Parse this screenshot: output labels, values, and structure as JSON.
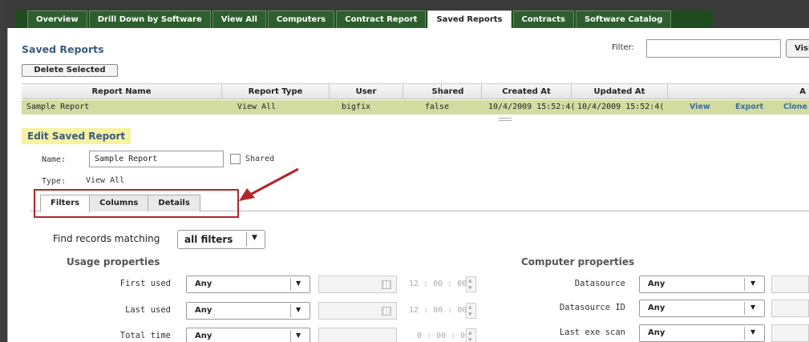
{
  "top_tabs": [
    {
      "label": "Overview",
      "active": false
    },
    {
      "label": "Drill Down by Software",
      "active": false
    },
    {
      "label": "View All",
      "active": false
    },
    {
      "label": "Computers",
      "active": false
    },
    {
      "label": "Contract Report",
      "active": false
    },
    {
      "label": "Saved Reports",
      "active": true
    },
    {
      "label": "Contracts",
      "active": false
    },
    {
      "label": "Software Catalog",
      "active": false
    }
  ],
  "page": {
    "title": "Saved Reports",
    "filter_label": "Filter:",
    "filter_value": "",
    "visible_button": "Visi",
    "delete_button": "Delete Selected"
  },
  "grid": {
    "columns": [
      "Report Name",
      "Report Type",
      "User",
      "Shared",
      "Created At",
      "Updated At",
      "A"
    ],
    "rows": [
      {
        "report_name": "Sample Report",
        "report_type": "View All",
        "user": "bigfix",
        "shared": "false",
        "created_at": "10/4/2009 15:52:4(",
        "updated_at": "10/4/2009 15:52:4(",
        "actions": [
          "View",
          "Export",
          "Clone"
        ]
      }
    ]
  },
  "edit": {
    "title": "Edit Saved Report",
    "name_label": "Name:",
    "name_value": "Sample Report",
    "shared_label": "Shared",
    "type_label": "Type:",
    "type_value": "View All",
    "subtabs": [
      {
        "label": "Filters",
        "active": true
      },
      {
        "label": "Columns",
        "active": false
      },
      {
        "label": "Details",
        "active": false
      }
    ]
  },
  "filters": {
    "find_label": "Find records matching",
    "match_mode": "all filters",
    "usage_heading": "Usage properties",
    "computer_heading": "Computer properties",
    "usage_rows": [
      {
        "label": "First used",
        "value": "Any",
        "time": "12 : 00 : 00"
      },
      {
        "label": "Last used",
        "value": "Any",
        "time": "12 : 00 : 00"
      },
      {
        "label": "Total time",
        "value": "Any",
        "time": "0 : 00 : 00"
      }
    ],
    "computer_rows": [
      {
        "label": "Datasource",
        "value": "Any"
      },
      {
        "label": "Datasource ID",
        "value": "Any"
      },
      {
        "label": "Last exe scan",
        "value": "Any"
      }
    ]
  }
}
